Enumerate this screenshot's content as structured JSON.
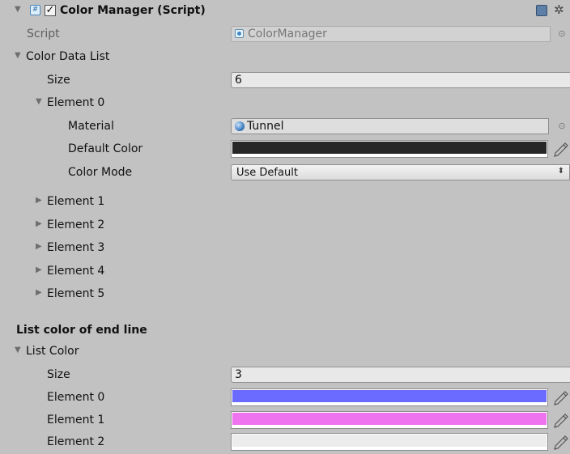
{
  "component": {
    "title": "Color Manager (Script)",
    "enabled": true,
    "script_label": "Script",
    "script_value": "ColorManager"
  },
  "color_data_list": {
    "label": "Color Data List",
    "size_label": "Size",
    "size_value": "6",
    "element0": {
      "label": "Element 0",
      "material_label": "Material",
      "material_value": "Tunnel",
      "default_color_label": "Default Color",
      "default_color": "#272727",
      "color_mode_label": "Color Mode",
      "color_mode_value": "Use Default"
    },
    "collapsed_elements": [
      "Element 1",
      "Element 2",
      "Element 3",
      "Element 4",
      "Element 5"
    ]
  },
  "section_header": "List color of end line",
  "list_color": {
    "label": "List Color",
    "size_label": "Size",
    "size_value": "3",
    "elements": [
      {
        "label": "Element 0",
        "color": "#6b6bff"
      },
      {
        "label": "Element 1",
        "color": "#ef72ef"
      },
      {
        "label": "Element 2",
        "color": "#ececec"
      }
    ]
  }
}
